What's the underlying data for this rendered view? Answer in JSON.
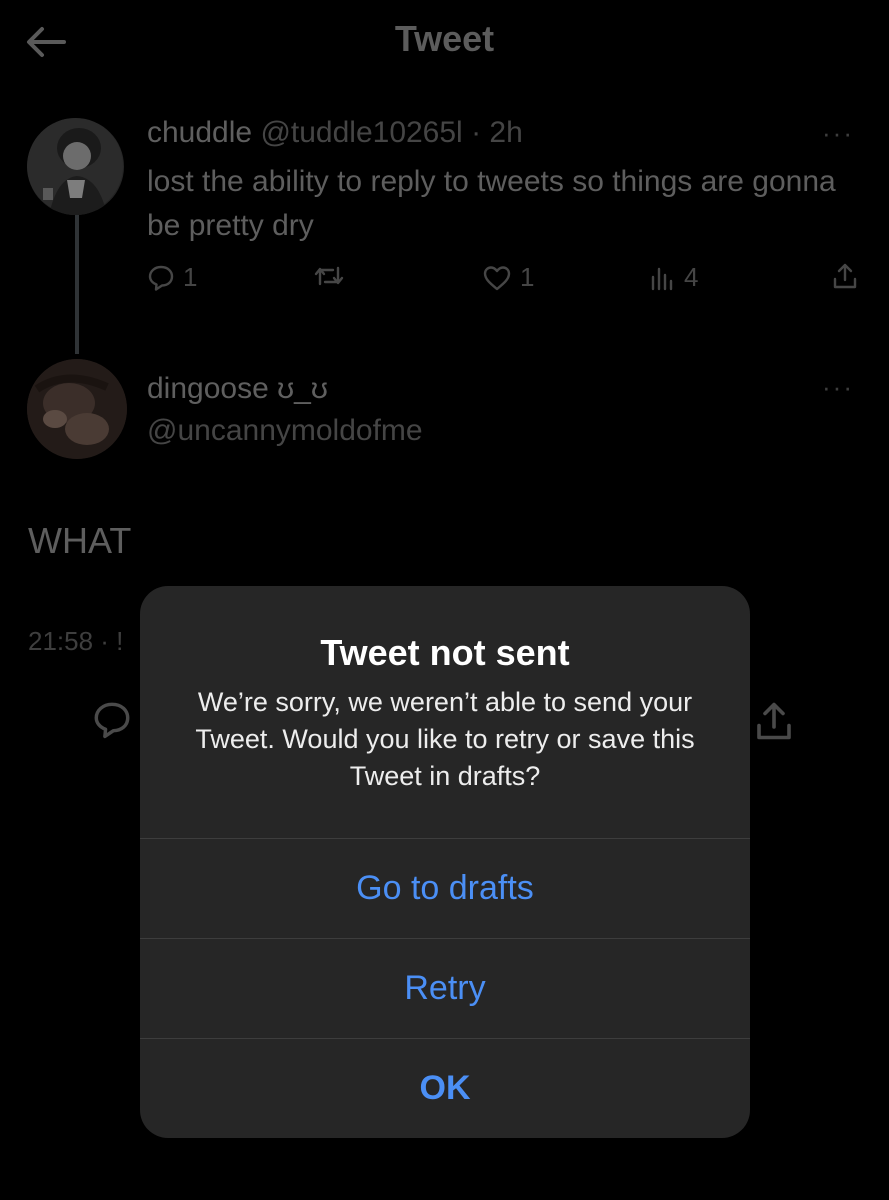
{
  "header": {
    "title": "Tweet"
  },
  "tweet1": {
    "name": "chuddle",
    "handle": "@tuddle10265l",
    "separator": "·",
    "time": "2h",
    "text": "lost the ability to reply to tweets so things are gonna be pretty dry",
    "more": "···",
    "replies": "1",
    "likes": "1",
    "views": "4"
  },
  "tweet2": {
    "name": "dingoose ʊ_ʊ",
    "handle": "@uncannymoldofme",
    "more": "···",
    "text": "WHAT",
    "timestamp": "21:58 · !"
  },
  "dialog": {
    "title": "Tweet not sent",
    "message": "We’re sorry, we weren’t able to send your Tweet. Would you like to retry or save this Tweet in drafts?",
    "buttons": {
      "drafts": "Go to drafts",
      "retry": "Retry",
      "ok": "OK"
    },
    "accent_color": "#4b8ff5"
  },
  "icons": {
    "back": "arrow-left-icon",
    "reply": "speech-bubble-icon",
    "retweet": "retweet-icon",
    "like": "heart-icon",
    "views": "bar-chart-icon",
    "share": "share-icon"
  }
}
